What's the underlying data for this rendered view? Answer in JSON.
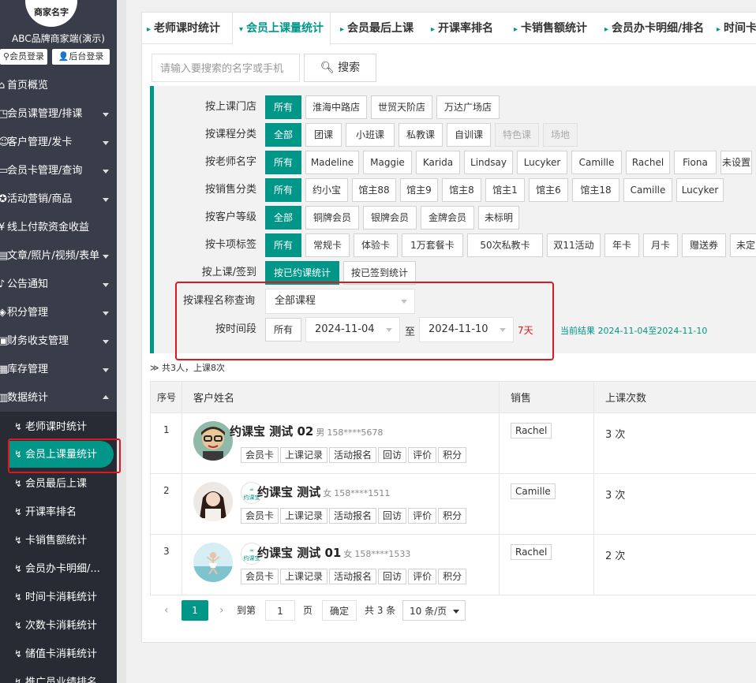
{
  "sidebar": {
    "logo_text": "商家名字",
    "brand": "ABC品牌商家端(演示)",
    "member_login": "会员登录",
    "admin_login": "后台登录",
    "items": [
      {
        "label": "首页概览",
        "has_caret": false
      },
      {
        "label": "会员课管理/排课",
        "has_caret": true
      },
      {
        "label": "客户管理/发卡",
        "has_caret": true
      },
      {
        "label": "会员卡管理/查询",
        "has_caret": true
      },
      {
        "label": "活动营销/商品",
        "has_caret": true
      },
      {
        "label": "线上付款资金收益",
        "has_caret": false
      },
      {
        "label": "文章/照片/视频/表单",
        "has_caret": true
      },
      {
        "label": "公告通知",
        "has_caret": true
      },
      {
        "label": "积分管理",
        "has_caret": true
      },
      {
        "label": "财务收支管理",
        "has_caret": true
      },
      {
        "label": "库存管理",
        "has_caret": true
      },
      {
        "label": "数据统计",
        "has_caret": true
      }
    ],
    "submenu": [
      {
        "label": "老师课时统计"
      },
      {
        "label": "会员上课量统计"
      },
      {
        "label": "会员最后上课"
      },
      {
        "label": "开课率排名"
      },
      {
        "label": "卡销售额统计"
      },
      {
        "label": "会员办卡明细/..."
      },
      {
        "label": "时间卡消耗统计"
      },
      {
        "label": "次数卡消耗统计"
      },
      {
        "label": "储值卡消耗统计"
      },
      {
        "label": "推广员业绩排名"
      }
    ]
  },
  "tabs": [
    {
      "label": "老师课时统计"
    },
    {
      "label": "会员上课量统计"
    },
    {
      "label": "会员最后上课"
    },
    {
      "label": "开课率排名"
    },
    {
      "label": "卡销售额统计"
    },
    {
      "label": "会员办卡明细/排名"
    },
    {
      "label": "时间卡"
    }
  ],
  "search": {
    "placeholder": "请输入要搜索的名字或手机",
    "button": "搜索"
  },
  "filters": {
    "store": {
      "label": "按上课门店",
      "options": [
        "所有",
        "淮海中路店",
        "世贸天阶店",
        "万达广场店"
      ]
    },
    "category": {
      "label": "按课程分类",
      "options": [
        "全部",
        "团课",
        "小班课",
        "私教课",
        "自训课",
        "特色课",
        "场地"
      ]
    },
    "teacher": {
      "label": "按老师名字",
      "options": [
        "所有",
        "Madeline",
        "Maggie",
        "Karida",
        "Lindsay",
        "Lucyker",
        "Camille",
        "Rachel",
        "Fiona",
        "未设置"
      ]
    },
    "sales": {
      "label": "按销售分类",
      "options": [
        "所有",
        "约小宝",
        "馆主88",
        "馆主9",
        "馆主8",
        "馆主1",
        "馆主6",
        "馆主18",
        "Camille",
        "Lucyker"
      ]
    },
    "level": {
      "label": "按客户等级",
      "options": [
        "全部",
        "铜牌会员",
        "银牌会员",
        "金牌会员",
        "未标明"
      ]
    },
    "card": {
      "label": "按卡项标签",
      "options": [
        "所有",
        "常规卡",
        "体验卡",
        "1万套餐卡",
        "50次私教卡",
        "双11活动",
        "年卡",
        "月卡",
        "赠送券",
        "未定"
      ]
    },
    "mode": {
      "label": "按上课/签到",
      "options": [
        "按已约课统计",
        "按已签到统计"
      ]
    },
    "course_name": {
      "label": "按课程名称查询",
      "value": "全部课程"
    },
    "period": {
      "label": "按时间段",
      "all": "所有",
      "start": "2024-11-04",
      "to": "至",
      "end": "2024-11-10",
      "days": "7天",
      "result": "当前结果 2024-11-04至2024-11-10"
    }
  },
  "summary": "≫ 共3人，上课8次",
  "table": {
    "headers": [
      "序号",
      "客户姓名",
      "销售",
      "上课次数"
    ],
    "rows": [
      {
        "no": "1",
        "name": "约课宝 测试 02",
        "gender": "男",
        "phone": "158****5678",
        "sales": "Rachel",
        "count": "3 次"
      },
      {
        "no": "2",
        "name": "约课宝 测试",
        "gender": "女",
        "phone": "158****1511",
        "sales": "Camille",
        "count": "3 次"
      },
      {
        "no": "3",
        "name": "约课宝 测试 01",
        "gender": "女",
        "phone": "158****1533",
        "sales": "Rachel",
        "count": "2 次"
      }
    ],
    "row_tags": [
      "会员卡",
      "上课记录",
      "活动报名",
      "回访",
      "评价",
      "积分"
    ],
    "brand_icon": "约课宝"
  },
  "pager": {
    "current": "1",
    "goto": "到第",
    "input": "1",
    "page_unit": "页",
    "confirm": "确定",
    "total": "共 3 条",
    "size": "10 条/页"
  },
  "colors": {
    "accent": "#009688",
    "sidebar": "#393d49",
    "annotation": "#e0171f"
  }
}
